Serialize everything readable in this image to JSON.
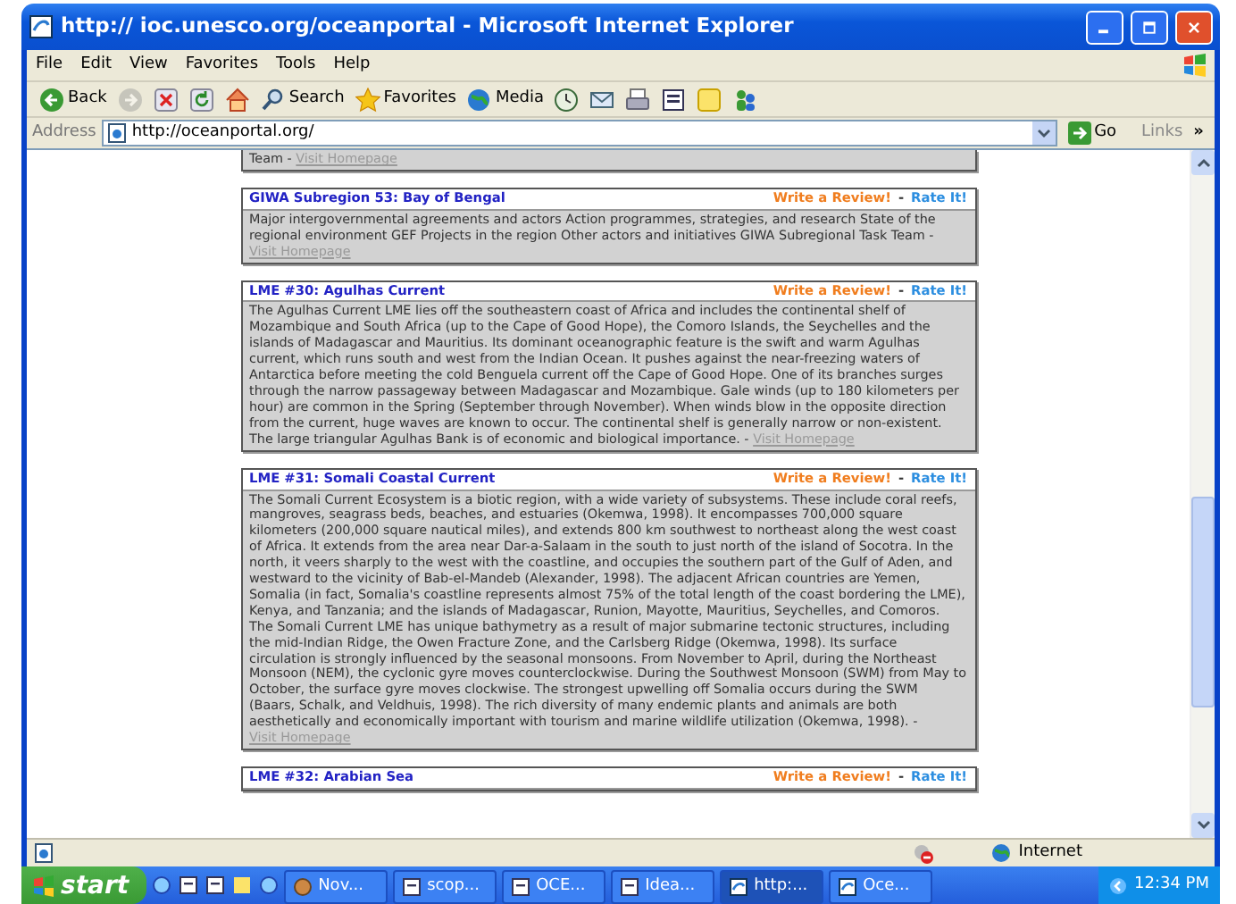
{
  "window": {
    "title": "http:// ioc.unesco.org/oceanportal - Microsoft Internet Explorer"
  },
  "menu": [
    "File",
    "Edit",
    "View",
    "Favorites",
    "Tools",
    "Help"
  ],
  "toolbar": [
    {
      "kind": "back",
      "label": "Back",
      "disabled": false
    },
    {
      "kind": "forward",
      "disabled": true
    },
    {
      "kind": "stop",
      "disabled": false
    },
    {
      "kind": "refresh",
      "disabled": false
    },
    {
      "kind": "home",
      "disabled": false
    },
    {
      "kind": "search",
      "label": "Search",
      "disabled": false
    },
    {
      "kind": "favorites",
      "label": "Favorites",
      "disabled": false
    },
    {
      "kind": "media",
      "label": "Media",
      "disabled": false
    },
    {
      "kind": "history",
      "disabled": false
    },
    {
      "kind": "mail",
      "disabled": false
    },
    {
      "kind": "print",
      "disabled": false
    },
    {
      "kind": "word",
      "disabled": false
    },
    {
      "kind": "note",
      "disabled": false
    },
    {
      "kind": "messenger",
      "disabled": false
    }
  ],
  "address": {
    "label": "Address",
    "url": "http://oceanportal.org/",
    "go": "Go",
    "links": "Links",
    "more": "»"
  },
  "entries": [
    {
      "kind": "tail",
      "body": "Team - ",
      "link": "Visit Homepage"
    },
    {
      "kind": "full",
      "title": "GIWA Subregion 53: Bay of Bengal",
      "review": "Write a Review!",
      "separator": "-",
      "rate": "Rate It!",
      "body": "Major intergovernmental agreements and actors Action programmes, strategies, and research State of the regional environment GEF Projects in the region Other actors and initiatives GIWA Subregional Task Team - ",
      "link": "Visit Homepage"
    },
    {
      "kind": "full",
      "title": "LME #30: Agulhas Current",
      "review": "Write a Review!",
      "separator": "-",
      "rate": "Rate It!",
      "body": "The Agulhas Current LME lies off the southeastern coast of Africa and includes the continental shelf of Mozambique and South Africa (up to the Cape of Good Hope), the Comoro Islands, the Seychelles and the islands of Madagascar and Mauritius. Its dominant oceanographic feature is the swift and warm Agulhas current, which runs south and west from the Indian Ocean. It pushes against the near-freezing waters of Antarctica before meeting the cold Benguela current off the Cape of Good Hope. One of its branches surges through the narrow passageway between Madagascar and Mozambique. Gale winds (up to 180 kilometers per hour) are common in the Spring (September through November). When winds blow in the opposite direction from the current, huge waves are known to occur. The continental shelf is generally narrow or non-existent. The large triangular Agulhas Bank is of economic and biological importance. - ",
      "link": "Visit Homepage"
    },
    {
      "kind": "full",
      "title": "LME #31: Somali Coastal Current",
      "review": "Write a Review!",
      "separator": "-",
      "rate": "Rate It!",
      "body": "The Somali Current Ecosystem is a biotic region, with a wide variety of subsystems. These include coral reefs, mangroves, seagrass beds, beaches, and estuaries (Okemwa, 1998). It encompasses 700,000 square kilometers (200,000 square nautical miles), and extends 800 km southwest to northeast along the west coast of Africa. It extends from the area near Dar-a-Salaam in the south to just north of the island of Socotra. In the north, it veers sharply to the west with the coastline, and occupies the southern part of the Gulf of Aden, and westward to the vicinity of Bab-el-Mandeb (Alexander, 1998). The adjacent African countries are Yemen, Somalia (in fact, Somalia's coastline represents almost 75% of the total length of the coast bordering the LME), Kenya, and Tanzania; and the islands of Madagascar, Runion, Mayotte, Mauritius, Seychelles, and Comoros. The Somali Current LME has unique bathymetry as a result of major submarine tectonic structures, including the mid-Indian Ridge, the Owen Fracture Zone, and the Carlsberg Ridge (Okemwa, 1998). Its surface circulation is strongly influenced by the seasonal monsoons. From November to April, during the Northeast Monsoon (NEM), the cyclonic gyre moves counterclockwise. During the Southwest Monsoon (SWM) from May to October, the surface gyre moves clockwise. The strongest upwelling off Somalia occurs during the SWM (Baars, Schalk, and Veldhuis, 1998). The rich diversity of many endemic plants and animals are both aesthetically and economically important with tourism and marine wildlife utilization (Okemwa, 1998). - ",
      "link": "Visit Homepage"
    },
    {
      "kind": "head",
      "title": "LME #32: Arabian Sea",
      "review": "Write a Review!",
      "separator": "-",
      "rate": "Rate It!"
    }
  ],
  "status": {
    "zone": "Internet"
  },
  "taskbar": {
    "start": "start",
    "tasks": [
      {
        "kind": "app",
        "label": "Nov...",
        "selected": false
      },
      {
        "kind": "word",
        "label": "scop...",
        "selected": false
      },
      {
        "kind": "word",
        "label": "OCE...",
        "selected": false
      },
      {
        "kind": "word",
        "label": "Idea...",
        "selected": false
      },
      {
        "kind": "ie",
        "label": "http:...",
        "selected": true
      },
      {
        "kind": "ie",
        "label": "Oce...",
        "selected": false
      }
    ],
    "clock": "12:34 PM"
  }
}
